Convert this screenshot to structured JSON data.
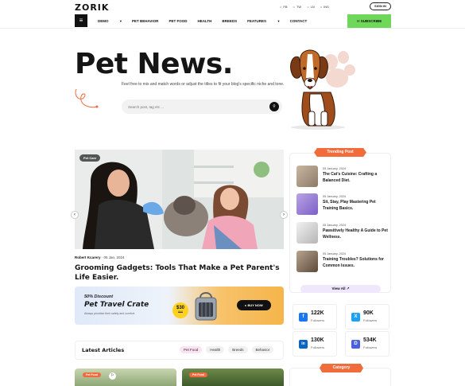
{
  "header": {
    "logo": "ZORIK",
    "socials": [
      "FB",
      "TW",
      "LN",
      "INS"
    ],
    "signin_label": "SIGN IN"
  },
  "nav": {
    "items": [
      "DEMO",
      "PET BEHAVIOR",
      "PET FOOD",
      "HEALTH",
      "BREEDS",
      "FEATURES",
      "CONTACT"
    ],
    "subscribe_label": "SUBSCRIBE"
  },
  "hero": {
    "title": "Pet News.",
    "description": "Feel free to mix and match words or adjust the titles to fit your blog's specific niche and tone.",
    "search_placeholder": "Search post, tag etc ..."
  },
  "feature": {
    "badge": "Pet Care",
    "author": "Robert Kcarery",
    "date": "05 Jan, 2024",
    "title": "Grooming Gadgets: Tools That Make a Pet Parent's Life Easier."
  },
  "banner": {
    "discount": "50% Discount",
    "title": "Pet Travel Crate",
    "subtitle": "Always prioritize their safety and comfort.",
    "price": "$30",
    "old_price": "$60",
    "buy_label": "BUY NOW"
  },
  "latest": {
    "title": "Latest Articles",
    "chips": [
      "Pet Food",
      "Health",
      "Breeds",
      "Behavior"
    ],
    "badges": [
      "Pet Food",
      "Pet Food"
    ]
  },
  "trending": {
    "label": "Trending Post",
    "items": [
      {
        "date": "05 January, 2024",
        "title": "The Cat's Cuisine: Crafting a Balanced Diet."
      },
      {
        "date": "05 January, 2024",
        "title": "Sit, Stay, Play Mastering Pet Training Basics."
      },
      {
        "date": "05 January, 2024",
        "title": "Pawsitively Healthy A Guide to Pet Wellness."
      },
      {
        "date": "05 January, 2024",
        "title": "Training Troubles? Solutions for Common Issues."
      }
    ],
    "view_all": "View All"
  },
  "stats": [
    {
      "icon": "f",
      "num": "122K",
      "label": "Followers",
      "color": "#1877f2"
    },
    {
      "icon": "X",
      "num": "90K",
      "label": "Followers",
      "color": "#1da1f2"
    },
    {
      "icon": "in",
      "num": "130K",
      "label": "Followers",
      "color": "#0a66c2"
    },
    {
      "icon": "D",
      "num": "534K",
      "label": "Followers",
      "color": "#4b5fe0"
    }
  ],
  "category": {
    "label": "Category"
  }
}
